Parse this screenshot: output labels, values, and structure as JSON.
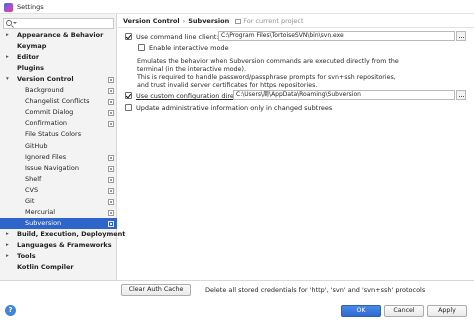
{
  "window": {
    "title": "Settings"
  },
  "search": {
    "placeholder": ""
  },
  "tree": [
    {
      "label": "Appearance & Behavior",
      "bold": true,
      "arrow": "▸",
      "level": 0,
      "selected": false,
      "cfg": false
    },
    {
      "label": "Keymap",
      "bold": true,
      "arrow": "",
      "level": 0,
      "selected": false,
      "cfg": false
    },
    {
      "label": "Editor",
      "bold": true,
      "arrow": "▸",
      "level": 0,
      "selected": false,
      "cfg": false
    },
    {
      "label": "Plugins",
      "bold": true,
      "arrow": "",
      "level": 0,
      "selected": false,
      "cfg": false
    },
    {
      "label": "Version Control",
      "bold": true,
      "arrow": "▾",
      "level": 0,
      "selected": false,
      "cfg": true
    },
    {
      "label": "Background",
      "bold": false,
      "arrow": "",
      "level": 1,
      "selected": false,
      "cfg": true
    },
    {
      "label": "Changelist Conflicts",
      "bold": false,
      "arrow": "",
      "level": 1,
      "selected": false,
      "cfg": true
    },
    {
      "label": "Commit Dialog",
      "bold": false,
      "arrow": "",
      "level": 1,
      "selected": false,
      "cfg": true
    },
    {
      "label": "Confirmation",
      "bold": false,
      "arrow": "",
      "level": 1,
      "selected": false,
      "cfg": true
    },
    {
      "label": "File Status Colors",
      "bold": false,
      "arrow": "",
      "level": 1,
      "selected": false,
      "cfg": false
    },
    {
      "label": "GitHub",
      "bold": false,
      "arrow": "",
      "level": 1,
      "selected": false,
      "cfg": false
    },
    {
      "label": "Ignored Files",
      "bold": false,
      "arrow": "",
      "level": 1,
      "selected": false,
      "cfg": true
    },
    {
      "label": "Issue Navigation",
      "bold": false,
      "arrow": "",
      "level": 1,
      "selected": false,
      "cfg": true
    },
    {
      "label": "Shelf",
      "bold": false,
      "arrow": "",
      "level": 1,
      "selected": false,
      "cfg": true
    },
    {
      "label": "CVS",
      "bold": false,
      "arrow": "",
      "level": 1,
      "selected": false,
      "cfg": true
    },
    {
      "label": "Git",
      "bold": false,
      "arrow": "",
      "level": 1,
      "selected": false,
      "cfg": true
    },
    {
      "label": "Mercurial",
      "bold": false,
      "arrow": "",
      "level": 1,
      "selected": false,
      "cfg": true
    },
    {
      "label": "Subversion",
      "bold": false,
      "arrow": "",
      "level": 1,
      "selected": true,
      "cfg": true
    },
    {
      "label": "Build, Execution, Deployment",
      "bold": true,
      "arrow": "▸",
      "level": 0,
      "selected": false,
      "cfg": false
    },
    {
      "label": "Languages & Frameworks",
      "bold": true,
      "arrow": "▸",
      "level": 0,
      "selected": false,
      "cfg": false
    },
    {
      "label": "Tools",
      "bold": true,
      "arrow": "▸",
      "level": 0,
      "selected": false,
      "cfg": false
    },
    {
      "label": "Kotlin Compiler",
      "bold": true,
      "arrow": "",
      "level": 0,
      "selected": false,
      "cfg": false
    }
  ],
  "breadcrumb": {
    "section": "Version Control",
    "separator": "›",
    "page": "Subversion",
    "scope": "For current project"
  },
  "svn": {
    "use_cmd_client_label": "Use command line client:",
    "use_cmd_client_checked": true,
    "cmd_client_path": "C:\\Program Files\\TortoiseSVN\\bin\\svn.exe",
    "interactive_mode_label": "Enable interactive mode",
    "interactive_mode_checked": false,
    "description": [
      "Emulates the behavior when Subversion commands are executed directly from the",
      "terminal (in the interactive mode).",
      "This is required to handle password/passphrase prompts for svn+ssh repositories,",
      "and trust invalid server certificates for https repositories."
    ],
    "custom_config_label": "Use custom configuration directory:",
    "custom_config_checked": true,
    "custom_config_path": "C:\\Users\\周\\AppData\\Roaming\\Subversion",
    "update_admin_label": "Update administrative information only in changed subtrees",
    "update_admin_checked": false,
    "clear_auth_label": "Clear Auth Cache",
    "clear_auth_desc": "Delete all stored credentials for 'http', 'svn' and 'svn+ssh' protocols"
  },
  "footer": {
    "ok": "OK",
    "cancel": "Cancel",
    "apply": "Apply",
    "help": "?"
  }
}
